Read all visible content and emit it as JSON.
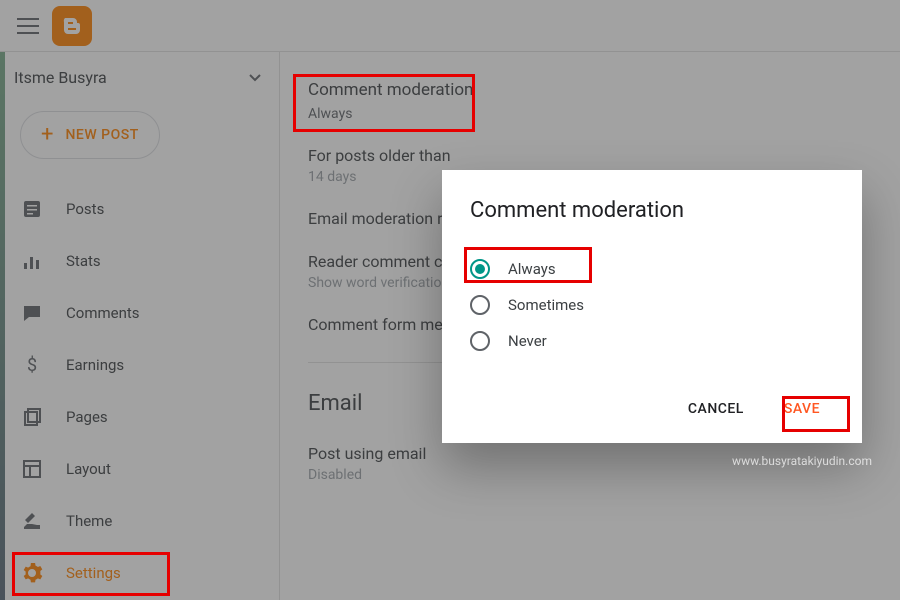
{
  "topbar": {
    "logo_letter": "B"
  },
  "sidebar": {
    "blog_name": "Itsme Busyra",
    "new_post": "NEW POST",
    "items": [
      {
        "label": "Posts",
        "icon": "posts-icon"
      },
      {
        "label": "Stats",
        "icon": "stats-icon"
      },
      {
        "label": "Comments",
        "icon": "comments-icon"
      },
      {
        "label": "Earnings",
        "icon": "earnings-icon"
      },
      {
        "label": "Pages",
        "icon": "pages-icon"
      },
      {
        "label": "Layout",
        "icon": "layout-icon"
      },
      {
        "label": "Theme",
        "icon": "theme-icon"
      },
      {
        "label": "Settings",
        "icon": "settings-icon"
      }
    ]
  },
  "content": {
    "comment_moderation": {
      "title": "Comment moderation",
      "value": "Always"
    },
    "posts_older": {
      "title": "For posts older than",
      "value": "14 days"
    },
    "email_moderation": {
      "title": "Email moderation requests to"
    },
    "reader_captcha": {
      "title": "Reader comment captcha",
      "sub": "Show word verification"
    },
    "comment_form": {
      "title": "Comment form message"
    },
    "email_section": "Email",
    "post_using_email": {
      "title": "Post using email",
      "value": "Disabled"
    }
  },
  "dialog": {
    "title": "Comment moderation",
    "options": [
      {
        "label": "Always",
        "selected": true
      },
      {
        "label": "Sometimes",
        "selected": false
      },
      {
        "label": "Never",
        "selected": false
      }
    ],
    "cancel": "CANCEL",
    "save": "SAVE"
  },
  "watermark": "www.busyratakiyudin.com"
}
